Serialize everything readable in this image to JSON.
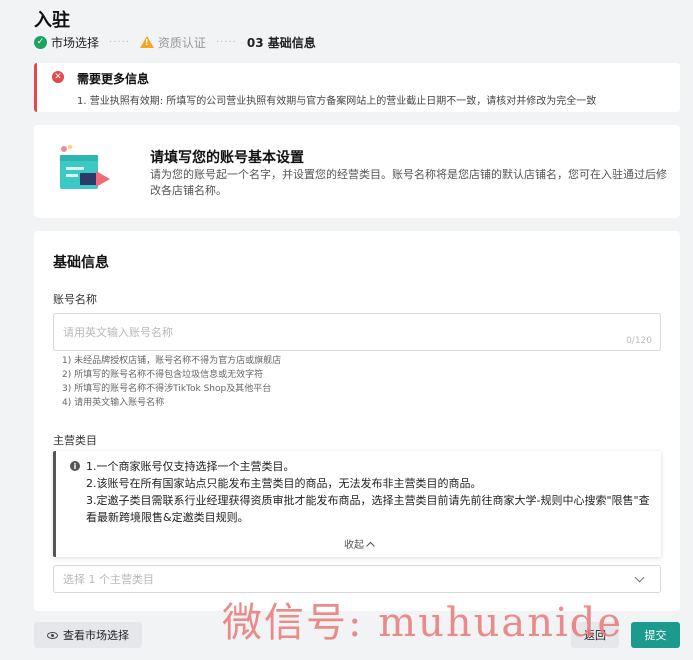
{
  "page": {
    "title": "入驻"
  },
  "steps": [
    {
      "label": "市场选择",
      "status": "done"
    },
    {
      "label": "资质认证",
      "status": "warning"
    },
    {
      "label": "03 基础信息",
      "status": "current"
    }
  ],
  "step_separator": "·····",
  "alert": {
    "title": "需要更多信息",
    "text": "1. 营业执照有效期: 所填写的公司营业执照有效期与官方备案网站上的营业截止日期不一致，请核对并修改为完全一致"
  },
  "intro": {
    "title": "请填写您的账号基本设置",
    "description": "请为您的账号起一个名字，并设置您的经营类目。账号名称将是您店铺的默认店铺名，您可在入驻通过后修改各店铺名称。"
  },
  "form": {
    "section_title": "基础信息",
    "account": {
      "label": "账号名称",
      "placeholder": "请用英文输入账号名称",
      "value": "",
      "counter": "0/120",
      "hints": [
        "1) 未经品牌授权店铺，账号名称不得为官方店或旗舰店",
        "2) 所填写的账号名称不得包含垃圾信息或无效字符",
        "3) 所填写的账号名称不得涉TikTok Shop及其他平台",
        "4) 请用英文输入账号名称"
      ]
    },
    "category": {
      "label": "主营类目",
      "notice": [
        "1.一个商家账号仅支持选择一个主营类目。",
        "2.该账号在所有国家站点只能发布主营类目的商品，无法发布非主营类目的商品。",
        "3.定邀子类目需联系行业经理获得资质审批才能发布商品，选择主营类目前请先前往商家大学-规则中心搜索\"限售\"查看最新跨境限售&定邀类目规则。"
      ],
      "collapse_label": "收起",
      "select_placeholder": "选择 1 个主营类目"
    }
  },
  "footer": {
    "view_market_label": "查看市场选择",
    "back_label": "返回",
    "submit_label": "提交"
  },
  "watermark": "微信号: muhuanide",
  "colors": {
    "success": "#1aa361",
    "warning": "#f5a623",
    "error": "#e04a4a",
    "primary": "#1c9a8e"
  }
}
